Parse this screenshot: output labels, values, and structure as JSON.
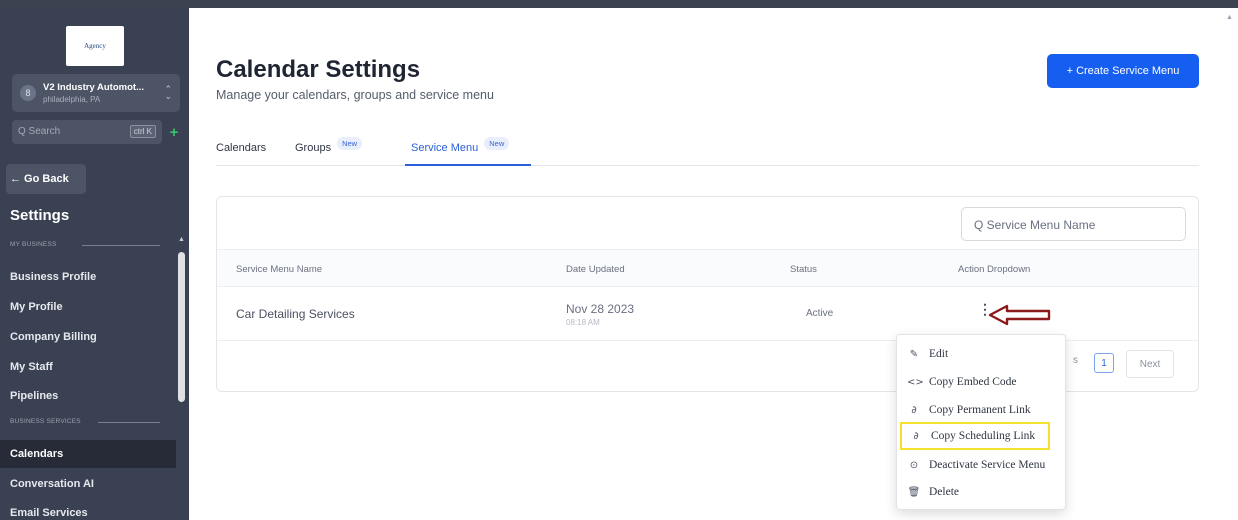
{
  "sidebar": {
    "logo_text": "Agency",
    "account": {
      "avatar": "8",
      "name": "V2 Industry Automot...",
      "location": "philadelphia, PA"
    },
    "search": {
      "placeholder": "Q Search",
      "shortcut": "ctrl K"
    },
    "plus": "+",
    "go_back": "← Go Back",
    "title": "Settings",
    "sections": {
      "my_business": "MY BUSINESS",
      "business_services": "BUSINESS SERVICES"
    },
    "items": [
      {
        "label": "Business Profile"
      },
      {
        "label": "My Profile"
      },
      {
        "label": "Company Billing"
      },
      {
        "label": "My Staff"
      },
      {
        "label": "Pipelines"
      },
      {
        "label": "Calendars"
      },
      {
        "label": "Conversation AI"
      },
      {
        "label": "Email Services"
      }
    ]
  },
  "header": {
    "title": "Calendar Settings",
    "subtitle": "Manage your calendars, groups and service menu",
    "create_button": "+ Create Service Menu"
  },
  "tabs": [
    {
      "label": "Calendars",
      "badge": ""
    },
    {
      "label": "Groups",
      "badge": "New"
    },
    {
      "label": "Service Menu",
      "badge": "New"
    }
  ],
  "table": {
    "search_placeholder": "Q Service Menu Name",
    "columns": [
      "Service Menu Name",
      "Date Updated",
      "Status",
      "Action Dropdown"
    ],
    "rows": [
      {
        "name": "Car Detailing Services",
        "date": "Nov 28 2023",
        "time": "08:18 AM",
        "status": "Active"
      }
    ],
    "pagination": {
      "prev": "s",
      "page": "1",
      "next": "Next"
    }
  },
  "action_menu": {
    "items": [
      {
        "label": "Edit",
        "icon": "pencil-icon"
      },
      {
        "label": "Copy Embed Code",
        "icon": "code-icon"
      },
      {
        "label": "Copy Permanent Link",
        "icon": "link-icon"
      },
      {
        "label": "Copy Scheduling Link",
        "icon": "link-icon",
        "highlighted": true
      },
      {
        "label": "Deactivate Service Menu",
        "icon": "deactivate-icon"
      },
      {
        "label": "Delete",
        "icon": "trash-icon"
      }
    ]
  },
  "colors": {
    "primary": "#155eef",
    "sidebar_bg": "#3a4152",
    "highlight_box": "#f3e12c",
    "annotation_arrow": "#8b1a1a"
  }
}
